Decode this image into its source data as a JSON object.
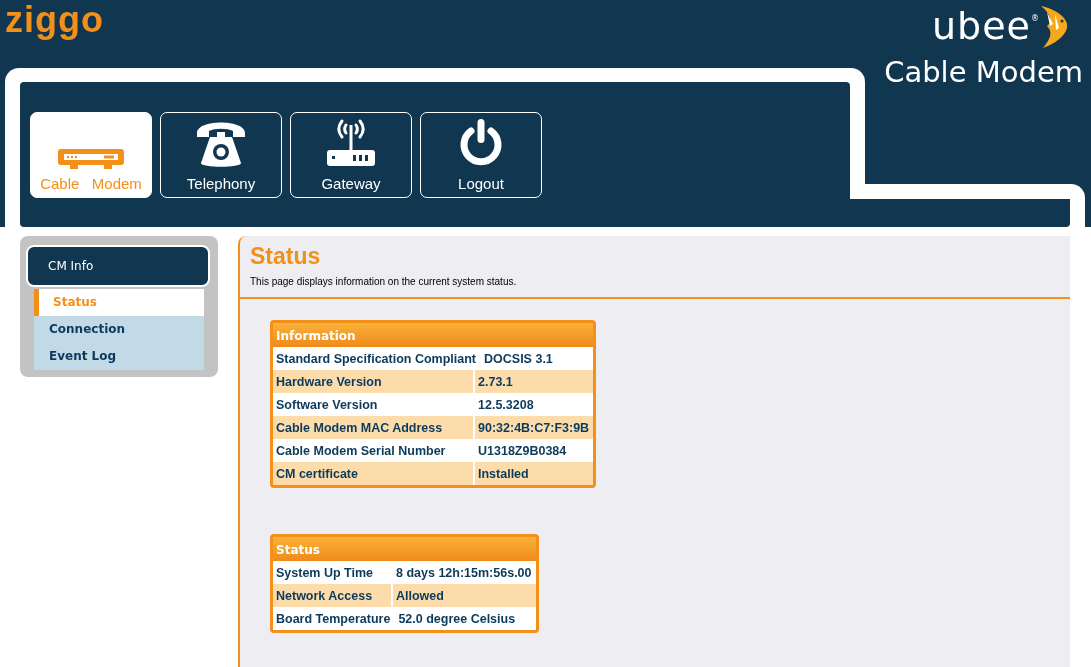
{
  "header": {
    "provider_logo": "ziggo",
    "brand_logo": "ubee",
    "brand_mark": "®",
    "title": "Cable Modem"
  },
  "nav": [
    {
      "label": "Cable   Modem",
      "kind": "modem",
      "selected": true
    },
    {
      "label": "Telephony",
      "kind": "phone",
      "selected": false
    },
    {
      "label": "Gateway",
      "kind": "router",
      "selected": false
    },
    {
      "label": "Logout",
      "kind": "power",
      "selected": false
    }
  ],
  "sidebar": {
    "group": "CM Info",
    "items": [
      {
        "label": "Status",
        "selected": true
      },
      {
        "label": "Connection",
        "selected": false
      },
      {
        "label": "Event Log",
        "selected": false
      }
    ]
  },
  "page": {
    "title": "Status",
    "description": "This page displays information on the current system status."
  },
  "tables": [
    {
      "title": "Information",
      "rows": [
        [
          "Standard Specification Compliant",
          "DOCSIS 3.1"
        ],
        [
          "Hardware Version",
          "2.73.1"
        ],
        [
          "Software Version",
          "12.5.3208"
        ],
        [
          "Cable Modem MAC Address",
          "90:32:4B:C7:F3:9B"
        ],
        [
          "Cable Modem Serial Number",
          "U1318Z9B0384"
        ],
        [
          "CM certificate",
          "Installed"
        ]
      ]
    },
    {
      "title": "Status",
      "rows": [
        [
          "System Up Time",
          "8 days 12h:15m:56s.00"
        ],
        [
          "Network Access",
          "Allowed"
        ],
        [
          "Board Temperature",
          "52.0 degree Celsius"
        ]
      ]
    }
  ]
}
